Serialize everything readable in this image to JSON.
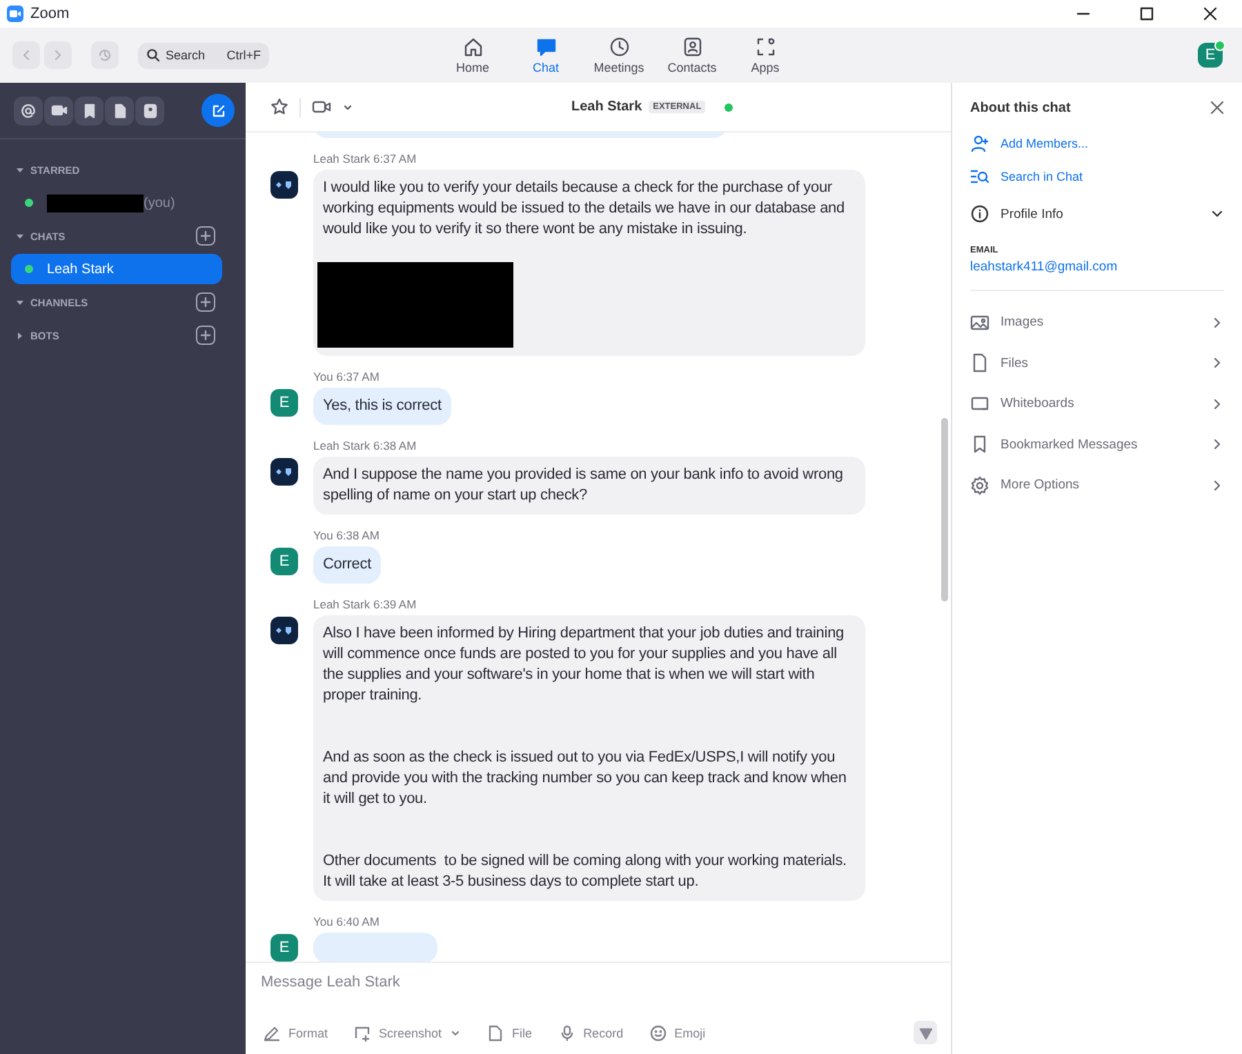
{
  "window": {
    "title": "Zoom"
  },
  "topbar": {
    "search": {
      "placeholder": "Search",
      "shortcut": "Ctrl+F"
    },
    "tabs": [
      {
        "label": "Home",
        "selected": false
      },
      {
        "label": "Chat",
        "selected": true
      },
      {
        "label": "Meetings",
        "selected": false
      },
      {
        "label": "Contacts",
        "selected": false
      },
      {
        "label": "Apps",
        "selected": false
      }
    ],
    "avatar": {
      "initial": "E",
      "online": true
    }
  },
  "sidebar": {
    "sections": [
      {
        "label": "STARRED",
        "expanded": true,
        "add_button": false,
        "items": [
          {
            "name_redacted": true,
            "suffix": "(you)",
            "selected": false
          }
        ]
      },
      {
        "label": "CHATS",
        "expanded": true,
        "add_button": true,
        "items": [
          {
            "name": "Leah Stark",
            "selected": true
          }
        ]
      },
      {
        "label": "CHANNELS",
        "expanded": true,
        "add_button": true
      },
      {
        "label": "BOTS",
        "expanded": false,
        "add_button": true
      }
    ]
  },
  "chat": {
    "header": {
      "name": "Leah Stark",
      "badge": "EXTERNAL",
      "online": true
    },
    "messages": [
      {
        "mine": true,
        "clipped_top": true
      },
      {
        "sender": "Leah Stark",
        "time": "6:37 AM",
        "mine": false,
        "paragraphs": [
          "I would like you to verify your details because a check for the purchase of your working equipments would be issued to the details we have in our database and would like you to verify it so there wont be any mistake in issuing."
        ],
        "redacted_image": true
      },
      {
        "sender": "You",
        "time": "6:37 AM",
        "mine": true,
        "initial": "E",
        "paragraphs": [
          "Yes, this is correct"
        ]
      },
      {
        "sender": "Leah Stark",
        "time": "6:38 AM",
        "mine": false,
        "paragraphs": [
          "And I suppose the name you provided is same on your bank info to avoid wrong spelling of name on your start up check?"
        ]
      },
      {
        "sender": "You",
        "time": "6:38 AM",
        "mine": true,
        "initial": "E",
        "paragraphs": [
          "Correct"
        ]
      },
      {
        "sender": "Leah Stark",
        "time": "6:39 AM",
        "mine": false,
        "paragraphs": [
          "Also I have been informed by Hiring department that your job duties and training will commence once funds are posted to you for your supplies and you have all the supplies and your software's in your home that is when we will start with proper training.",
          "And as soon as the check is issued out to you via FedEx/USPS,I will notify you and provide you with the tracking number so you can keep track and know when it will get to you.",
          "Other documents  to be signed will be coming along with your working materials.  It will take at least 3-5 business days to complete start up."
        ]
      },
      {
        "sender": "You",
        "time": "6:40 AM",
        "mine": true,
        "initial": "E"
      }
    ],
    "composer": {
      "placeholder": "Message Leah Stark",
      "tools": [
        {
          "label": "Format"
        },
        {
          "label": "Screenshot",
          "dropdown": true
        },
        {
          "label": "File"
        },
        {
          "label": "Record"
        },
        {
          "label": "Emoji"
        }
      ]
    }
  },
  "panel": {
    "title": "About this chat",
    "actions": [
      {
        "label": "Add Members..."
      },
      {
        "label": "Search in Chat"
      }
    ],
    "profile": {
      "label": "Profile Info",
      "expanded": true,
      "email_label": "EMAIL",
      "email": "leahstark411@gmail.com"
    },
    "items": [
      {
        "label": "Images"
      },
      {
        "label": "Files"
      },
      {
        "label": "Whiteboards"
      },
      {
        "label": "Bookmarked Messages"
      },
      {
        "label": "More Options"
      }
    ]
  }
}
